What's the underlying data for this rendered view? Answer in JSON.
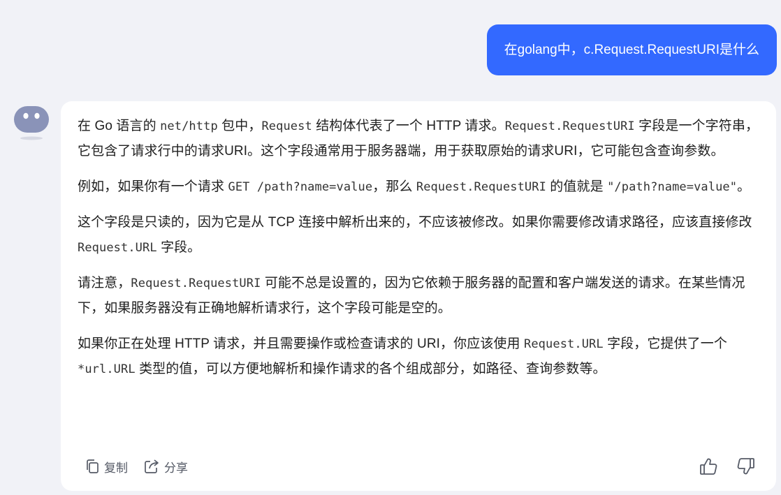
{
  "user_message": "在golang中，c.Request.RequestURI是什么",
  "answer": {
    "p1": {
      "t1": "在 Go 语言的 ",
      "c1": "net/http",
      "t2": " 包中，",
      "c2": "Request",
      "t3": " 结构体代表了一个 HTTP 请求。",
      "c3": "Request.RequestURI",
      "t4": " 字段是一个字符串，它包含了请求行中的请求URI。这个字段通常用于服务器端，用于获取原始的请求URI，它可能包含查询参数。"
    },
    "p2": {
      "t1": "例如，如果你有一个请求 ",
      "c1": "GET /path?name=value",
      "t2": "，那么 ",
      "c2": "Request.RequestURI",
      "t3": " 的值就是 ",
      "c3": "\"/path?name=value\"",
      "t4": "。"
    },
    "p3": {
      "t1": "这个字段是只读的，因为它是从 TCP 连接中解析出来的，不应该被修改。如果你需要修改请求路径，应该直接修改 ",
      "c1": "Request.URL",
      "t2": " 字段。"
    },
    "p4": {
      "t1": "请注意，",
      "c1": "Request.RequestURI",
      "t2": " 可能不总是设置的，因为它依赖于服务器的配置和客户端发送的请求。在某些情况下，如果服务器没有正确地解析请求行，这个字段可能是空的。"
    },
    "p5": {
      "t1": "如果你正在处理 HTTP 请求，并且需要操作或检查请求的 URI，你应该使用 ",
      "c1": "Request.URL",
      "t2": " 字段，它提供了一个 ",
      "c2": "*url.URL",
      "t3": " 类型的值，可以方便地解析和操作请求的各个组成部分，如路径、查询参数等。"
    }
  },
  "actions": {
    "copy_label": "复制",
    "share_label": "分享",
    "copy_icon": "copy-icon",
    "share_icon": "share-icon",
    "like_icon": "thumbs-up-icon",
    "dislike_icon": "thumbs-down-icon"
  },
  "colors": {
    "user_bubble": "#3369ff",
    "background": "#f1f2f7",
    "card": "#ffffff",
    "avatar": "#8a93b8"
  }
}
